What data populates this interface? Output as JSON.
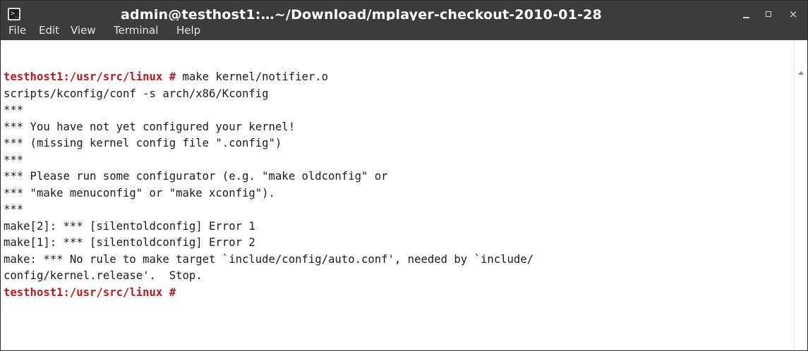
{
  "window": {
    "title": "admin@testhost1:…~/Download/mplayer-checkout-2010-01-28",
    "icon": "terminal-icon",
    "icon_glyph": ">_",
    "controls": {
      "minimize": "minimize-icon",
      "maximize": "maximize-icon",
      "close": "close-icon",
      "close_glyph": "×"
    }
  },
  "menubar": {
    "items": [
      {
        "label": "File"
      },
      {
        "label": "Edit"
      },
      {
        "label": "View"
      },
      {
        "label": "Terminal"
      },
      {
        "label": "Help"
      }
    ]
  },
  "terminal": {
    "prompt": "testhost1:/usr/src/linux #",
    "command": " make kernel/notifier.o",
    "output": [
      "scripts/kconfig/conf -s arch/x86/Kconfig",
      "***",
      "*** You have not yet configured your kernel!",
      "*** (missing kernel config file \".config\")",
      "***",
      "*** Please run some configurator (e.g. \"make oldconfig\" or",
      "*** \"make menuconfig\" or \"make xconfig\").",
      "***",
      "make[2]: *** [silentoldconfig] Error 1",
      "make[1]: *** [silentoldconfig] Error 2",
      "make: *** No rule to make target `include/config/auto.conf', needed by `include/",
      "config/kernel.release'.  Stop."
    ],
    "final_prompt": "testhost1:/usr/src/linux #",
    "colors": {
      "prompt": "#c0181a",
      "text": "#1a1a1a",
      "background": "#ffffff",
      "titlebar": "#3c3c3c"
    }
  },
  "scrollbar": {
    "up_arrow": "chevron-up-icon"
  }
}
